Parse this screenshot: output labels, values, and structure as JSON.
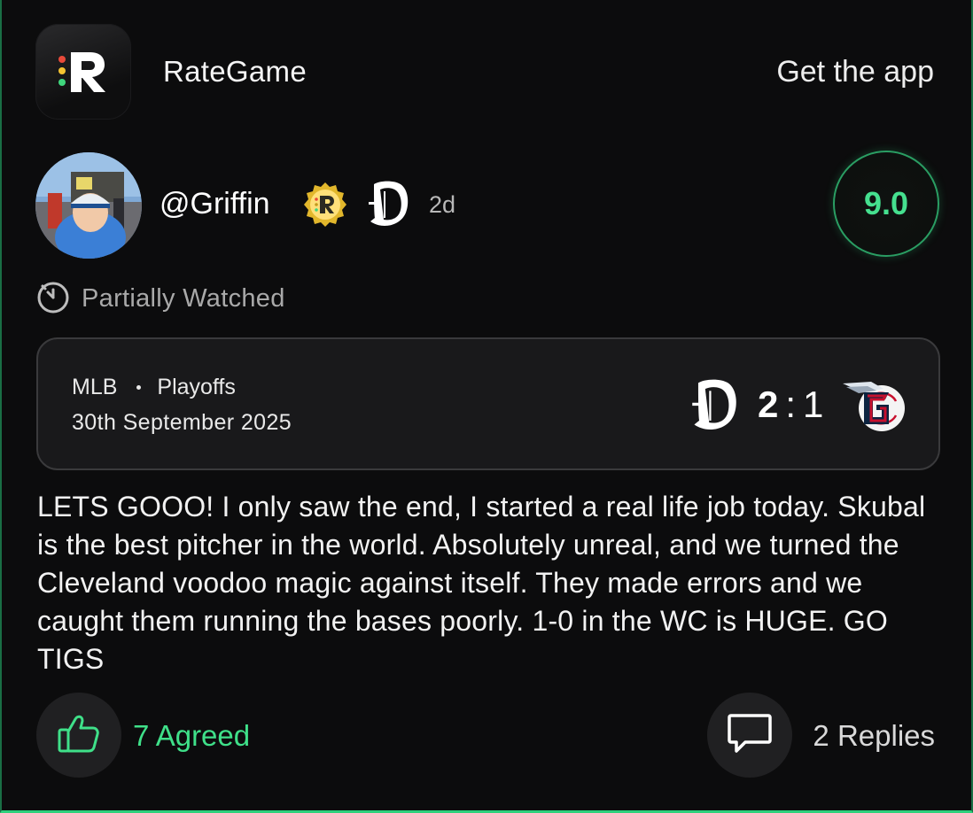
{
  "header": {
    "app_name": "RateGame",
    "get_app_label": "Get the app",
    "app_icon": "rategame-logo-icon"
  },
  "post": {
    "username": "@Griffin",
    "time_ago": "2d",
    "badge_icon": "rategame-badge-icon",
    "team_icon": "detroit-tigers-logo",
    "rating": "9.0",
    "watch_status": "Partially Watched",
    "watch_icon": "stopwatch-icon",
    "text": "LETS GOOO! I only saw the end, I started a real life job today. Skubal is the best pitcher in the world. Absolutely unreal, and we turned the Cleveland voodoo magic against itself. They made errors and we caught them running the bases poorly. 1-0 in the WC is HUGE. GO TIGS"
  },
  "game": {
    "league": "MLB",
    "stage": "Playoffs",
    "date": "30th September 2025",
    "home_score": "2",
    "separator": ":",
    "away_score": "1",
    "home_team_icon": "detroit-tigers-logo",
    "away_team_icon": "cleveland-guardians-logo"
  },
  "actions": {
    "agree_label": "7 Agreed",
    "agree_icon": "thumbs-up-icon",
    "reply_label": "2 Replies",
    "reply_icon": "speech-bubble-icon"
  },
  "colors": {
    "accent_green": "#3fe089",
    "background": "#0c0c0d",
    "card": "#19191b"
  }
}
